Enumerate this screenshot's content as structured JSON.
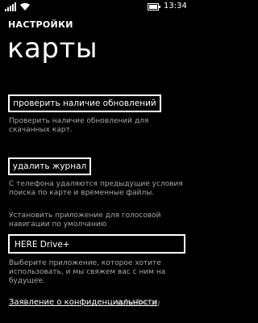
{
  "status_bar": {
    "time": "13:34",
    "icons": [
      "signal-icon",
      "wifi-icon",
      "battery-icon"
    ]
  },
  "header": {
    "section_title": "НАСТРОЙКИ",
    "page_title": "карты"
  },
  "updates": {
    "button_label": "проверить наличие обновлений",
    "description": "Проверить наличие обновлений для скачанных карт."
  },
  "history": {
    "button_label": "удалить журнал",
    "description": "С телефона удаляются предыдущие условия поиска по карте и временные файлы."
  },
  "voice_app": {
    "label": "Установить приложение для голосовой навигации по умолчанию",
    "selected_value": "HERE Drive+",
    "description": "Выберите приложение, которое хотите использовать, и мы свяжем вас с ним на будущее."
  },
  "privacy": {
    "link_text": "Заявление о конфиденциальности"
  },
  "watermark": {
    "text": "wintiles.ru"
  },
  "colors": {
    "background": "#000000",
    "text": "#ffffff",
    "secondary_text": "#a6a6a6"
  }
}
